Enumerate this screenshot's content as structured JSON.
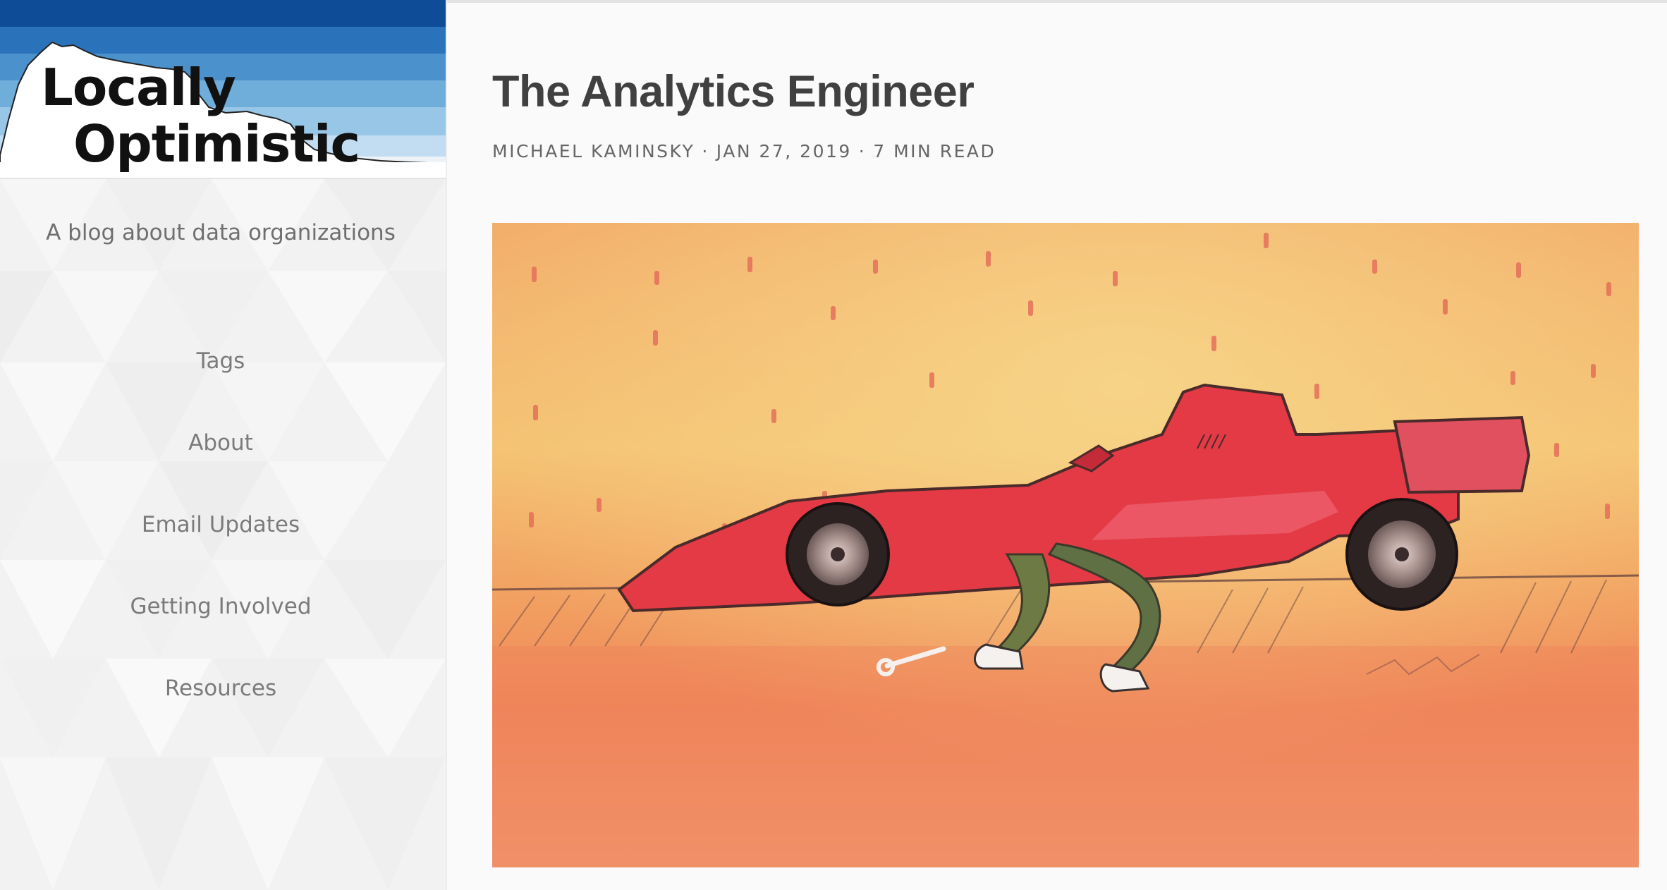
{
  "sidebar": {
    "logo": {
      "line1": "Locally",
      "line2": "Optimistic"
    },
    "tagline": "A blog about data organizations",
    "nav": [
      {
        "label": "Tags"
      },
      {
        "label": "About"
      },
      {
        "label": "Email Updates"
      },
      {
        "label": "Getting Involved"
      },
      {
        "label": "Resources"
      }
    ]
  },
  "post": {
    "title": "The Analytics Engineer",
    "author": "MICHAEL KAMINSKY",
    "separator": "·",
    "date": "JAN 27, 2019",
    "read_time": "7 MIN READ",
    "hero_image": "watercolor-race-car-mechanic-illustration"
  },
  "colors": {
    "logo_stripes": [
      "#0f4c97",
      "#2a73ba",
      "#4b92cd",
      "#6fadda",
      "#98c6e6",
      "#c2dcf1",
      "#e6eef6"
    ],
    "title": "#404040",
    "nav_text": "#7b7b7b"
  }
}
